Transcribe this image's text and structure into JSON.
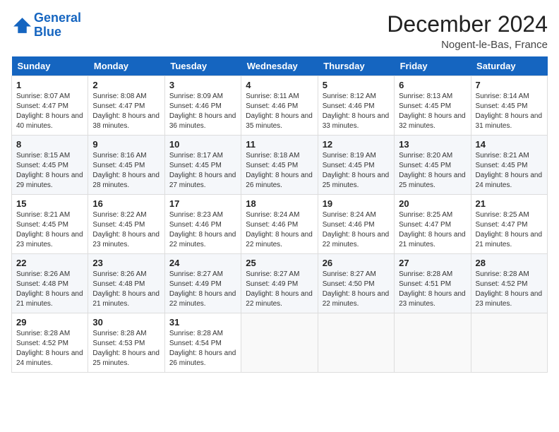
{
  "logo": {
    "line1": "General",
    "line2": "Blue"
  },
  "title": "December 2024",
  "location": "Nogent-le-Bas, France",
  "headers": [
    "Sunday",
    "Monday",
    "Tuesday",
    "Wednesday",
    "Thursday",
    "Friday",
    "Saturday"
  ],
  "weeks": [
    [
      {
        "day": "1",
        "sunrise": "Sunrise: 8:07 AM",
        "sunset": "Sunset: 4:47 PM",
        "daylight": "Daylight: 8 hours and 40 minutes."
      },
      {
        "day": "2",
        "sunrise": "Sunrise: 8:08 AM",
        "sunset": "Sunset: 4:47 PM",
        "daylight": "Daylight: 8 hours and 38 minutes."
      },
      {
        "day": "3",
        "sunrise": "Sunrise: 8:09 AM",
        "sunset": "Sunset: 4:46 PM",
        "daylight": "Daylight: 8 hours and 36 minutes."
      },
      {
        "day": "4",
        "sunrise": "Sunrise: 8:11 AM",
        "sunset": "Sunset: 4:46 PM",
        "daylight": "Daylight: 8 hours and 35 minutes."
      },
      {
        "day": "5",
        "sunrise": "Sunrise: 8:12 AM",
        "sunset": "Sunset: 4:46 PM",
        "daylight": "Daylight: 8 hours and 33 minutes."
      },
      {
        "day": "6",
        "sunrise": "Sunrise: 8:13 AM",
        "sunset": "Sunset: 4:45 PM",
        "daylight": "Daylight: 8 hours and 32 minutes."
      },
      {
        "day": "7",
        "sunrise": "Sunrise: 8:14 AM",
        "sunset": "Sunset: 4:45 PM",
        "daylight": "Daylight: 8 hours and 31 minutes."
      }
    ],
    [
      {
        "day": "8",
        "sunrise": "Sunrise: 8:15 AM",
        "sunset": "Sunset: 4:45 PM",
        "daylight": "Daylight: 8 hours and 29 minutes."
      },
      {
        "day": "9",
        "sunrise": "Sunrise: 8:16 AM",
        "sunset": "Sunset: 4:45 PM",
        "daylight": "Daylight: 8 hours and 28 minutes."
      },
      {
        "day": "10",
        "sunrise": "Sunrise: 8:17 AM",
        "sunset": "Sunset: 4:45 PM",
        "daylight": "Daylight: 8 hours and 27 minutes."
      },
      {
        "day": "11",
        "sunrise": "Sunrise: 8:18 AM",
        "sunset": "Sunset: 4:45 PM",
        "daylight": "Daylight: 8 hours and 26 minutes."
      },
      {
        "day": "12",
        "sunrise": "Sunrise: 8:19 AM",
        "sunset": "Sunset: 4:45 PM",
        "daylight": "Daylight: 8 hours and 25 minutes."
      },
      {
        "day": "13",
        "sunrise": "Sunrise: 8:20 AM",
        "sunset": "Sunset: 4:45 PM",
        "daylight": "Daylight: 8 hours and 25 minutes."
      },
      {
        "day": "14",
        "sunrise": "Sunrise: 8:21 AM",
        "sunset": "Sunset: 4:45 PM",
        "daylight": "Daylight: 8 hours and 24 minutes."
      }
    ],
    [
      {
        "day": "15",
        "sunrise": "Sunrise: 8:21 AM",
        "sunset": "Sunset: 4:45 PM",
        "daylight": "Daylight: 8 hours and 23 minutes."
      },
      {
        "day": "16",
        "sunrise": "Sunrise: 8:22 AM",
        "sunset": "Sunset: 4:45 PM",
        "daylight": "Daylight: 8 hours and 23 minutes."
      },
      {
        "day": "17",
        "sunrise": "Sunrise: 8:23 AM",
        "sunset": "Sunset: 4:46 PM",
        "daylight": "Daylight: 8 hours and 22 minutes."
      },
      {
        "day": "18",
        "sunrise": "Sunrise: 8:24 AM",
        "sunset": "Sunset: 4:46 PM",
        "daylight": "Daylight: 8 hours and 22 minutes."
      },
      {
        "day": "19",
        "sunrise": "Sunrise: 8:24 AM",
        "sunset": "Sunset: 4:46 PM",
        "daylight": "Daylight: 8 hours and 22 minutes."
      },
      {
        "day": "20",
        "sunrise": "Sunrise: 8:25 AM",
        "sunset": "Sunset: 4:47 PM",
        "daylight": "Daylight: 8 hours and 21 minutes."
      },
      {
        "day": "21",
        "sunrise": "Sunrise: 8:25 AM",
        "sunset": "Sunset: 4:47 PM",
        "daylight": "Daylight: 8 hours and 21 minutes."
      }
    ],
    [
      {
        "day": "22",
        "sunrise": "Sunrise: 8:26 AM",
        "sunset": "Sunset: 4:48 PM",
        "daylight": "Daylight: 8 hours and 21 minutes."
      },
      {
        "day": "23",
        "sunrise": "Sunrise: 8:26 AM",
        "sunset": "Sunset: 4:48 PM",
        "daylight": "Daylight: 8 hours and 21 minutes."
      },
      {
        "day": "24",
        "sunrise": "Sunrise: 8:27 AM",
        "sunset": "Sunset: 4:49 PM",
        "daylight": "Daylight: 8 hours and 22 minutes."
      },
      {
        "day": "25",
        "sunrise": "Sunrise: 8:27 AM",
        "sunset": "Sunset: 4:49 PM",
        "daylight": "Daylight: 8 hours and 22 minutes."
      },
      {
        "day": "26",
        "sunrise": "Sunrise: 8:27 AM",
        "sunset": "Sunset: 4:50 PM",
        "daylight": "Daylight: 8 hours and 22 minutes."
      },
      {
        "day": "27",
        "sunrise": "Sunrise: 8:28 AM",
        "sunset": "Sunset: 4:51 PM",
        "daylight": "Daylight: 8 hours and 23 minutes."
      },
      {
        "day": "28",
        "sunrise": "Sunrise: 8:28 AM",
        "sunset": "Sunset: 4:52 PM",
        "daylight": "Daylight: 8 hours and 23 minutes."
      }
    ],
    [
      {
        "day": "29",
        "sunrise": "Sunrise: 8:28 AM",
        "sunset": "Sunset: 4:52 PM",
        "daylight": "Daylight: 8 hours and 24 minutes."
      },
      {
        "day": "30",
        "sunrise": "Sunrise: 8:28 AM",
        "sunset": "Sunset: 4:53 PM",
        "daylight": "Daylight: 8 hours and 25 minutes."
      },
      {
        "day": "31",
        "sunrise": "Sunrise: 8:28 AM",
        "sunset": "Sunset: 4:54 PM",
        "daylight": "Daylight: 8 hours and 26 minutes."
      },
      null,
      null,
      null,
      null
    ]
  ]
}
